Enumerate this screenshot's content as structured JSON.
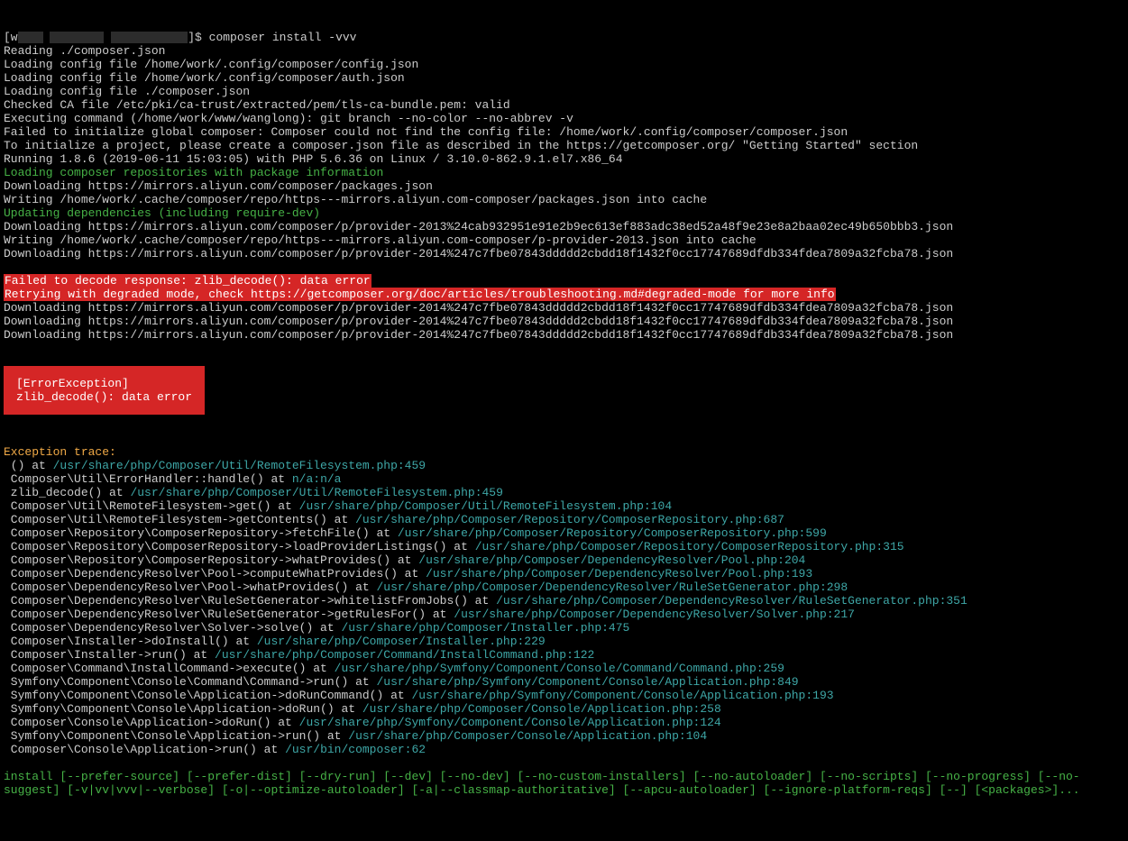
{
  "prompt_prefix": "[w",
  "prompt_suffix": "]$ ",
  "command": "composer install -vvv",
  "lines": [
    "Reading ./composer.json",
    "Loading config file /home/work/.config/composer/config.json",
    "Loading config file /home/work/.config/composer/auth.json",
    "Loading config file ./composer.json",
    "Checked CA file /etc/pki/ca-trust/extracted/pem/tls-ca-bundle.pem: valid",
    "Executing command (/home/work/www/wanglong): git branch --no-color --no-abbrev -v",
    "Failed to initialize global composer: Composer could not find the config file: /home/work/.config/composer/composer.json",
    "To initialize a project, please create a composer.json file as described in the https://getcomposer.org/ \"Getting Started\" section",
    "Running 1.8.6 (2019-06-11 15:03:05) with PHP 5.6.36 on Linux / 3.10.0-862.9.1.el7.x86_64"
  ],
  "status1": "Loading composer repositories with package information",
  "lines2": [
    "Downloading https://mirrors.aliyun.com/composer/packages.json",
    "Writing /home/work/.cache/composer/repo/https---mirrors.aliyun.com-composer/packages.json into cache"
  ],
  "status2": "Updating dependencies (including require-dev)",
  "lines3": [
    "Downloading https://mirrors.aliyun.com/composer/p/provider-2013%24cab932951e91e2b9ec613ef883adc38ed52a48f9e23e8a2baa02ec49b650bbb3.json",
    "Writing /home/work/.cache/composer/repo/https---mirrors.aliyun.com-composer/p-provider-2013.json into cache",
    "Downloading https://mirrors.aliyun.com/composer/p/provider-2014%247c7fbe07843ddddd2cbdd18f1432f0cc17747689dfdb334fdea7809a32fcba78.json"
  ],
  "err_hl1": "Failed to decode response: zlib_decode(): data error",
  "err_hl2": "Retrying with degraded mode, check https://getcomposer.org/doc/articles/troubleshooting.md#degraded-mode for more info",
  "lines4": [
    "Downloading https://mirrors.aliyun.com/composer/p/provider-2014%247c7fbe07843ddddd2cbdd18f1432f0cc17747689dfdb334fdea7809a32fcba78.json",
    "Downloading https://mirrors.aliyun.com/composer/p/provider-2014%247c7fbe07843ddddd2cbdd18f1432f0cc17747689dfdb334fdea7809a32fcba78.json",
    "Downloading https://mirrors.aliyun.com/composer/p/provider-2014%247c7fbe07843ddddd2cbdd18f1432f0cc17747689dfdb334fdea7809a32fcba78.json"
  ],
  "errbox": {
    "title": "[ErrorException]",
    "msg": "zlib_decode(): data error"
  },
  "trace_header": "Exception trace:",
  "trace": [
    {
      "call": " () at ",
      "path": "/usr/share/php/Composer/Util/RemoteFilesystem.php:459"
    },
    {
      "call": " Composer\\Util\\ErrorHandler::handle() at ",
      "path": "n/a:n/a"
    },
    {
      "call": " zlib_decode() at ",
      "path": "/usr/share/php/Composer/Util/RemoteFilesystem.php:459"
    },
    {
      "call": " Composer\\Util\\RemoteFilesystem->get() at ",
      "path": "/usr/share/php/Composer/Util/RemoteFilesystem.php:104"
    },
    {
      "call": " Composer\\Util\\RemoteFilesystem->getContents() at ",
      "path": "/usr/share/php/Composer/Repository/ComposerRepository.php:687"
    },
    {
      "call": " Composer\\Repository\\ComposerRepository->fetchFile() at ",
      "path": "/usr/share/php/Composer/Repository/ComposerRepository.php:599"
    },
    {
      "call": " Composer\\Repository\\ComposerRepository->loadProviderListings() at ",
      "path": "/usr/share/php/Composer/Repository/ComposerRepository.php:315"
    },
    {
      "call": " Composer\\Repository\\ComposerRepository->whatProvides() at ",
      "path": "/usr/share/php/Composer/DependencyResolver/Pool.php:204"
    },
    {
      "call": " Composer\\DependencyResolver\\Pool->computeWhatProvides() at ",
      "path": "/usr/share/php/Composer/DependencyResolver/Pool.php:193"
    },
    {
      "call": " Composer\\DependencyResolver\\Pool->whatProvides() at ",
      "path": "/usr/share/php/Composer/DependencyResolver/RuleSetGenerator.php:298"
    },
    {
      "call": " Composer\\DependencyResolver\\RuleSetGenerator->whitelistFromJobs() at ",
      "path": "/usr/share/php/Composer/DependencyResolver/RuleSetGenerator.php:351"
    },
    {
      "call": " Composer\\DependencyResolver\\RuleSetGenerator->getRulesFor() at ",
      "path": "/usr/share/php/Composer/DependencyResolver/Solver.php:217"
    },
    {
      "call": " Composer\\DependencyResolver\\Solver->solve() at ",
      "path": "/usr/share/php/Composer/Installer.php:475"
    },
    {
      "call": " Composer\\Installer->doInstall() at ",
      "path": "/usr/share/php/Composer/Installer.php:229"
    },
    {
      "call": " Composer\\Installer->run() at ",
      "path": "/usr/share/php/Composer/Command/InstallCommand.php:122"
    },
    {
      "call": " Composer\\Command\\InstallCommand->execute() at ",
      "path": "/usr/share/php/Symfony/Component/Console/Command/Command.php:259"
    },
    {
      "call": " Symfony\\Component\\Console\\Command\\Command->run() at ",
      "path": "/usr/share/php/Symfony/Component/Console/Application.php:849"
    },
    {
      "call": " Symfony\\Component\\Console\\Application->doRunCommand() at ",
      "path": "/usr/share/php/Symfony/Component/Console/Application.php:193"
    },
    {
      "call": " Symfony\\Component\\Console\\Application->doRun() at ",
      "path": "/usr/share/php/Composer/Console/Application.php:258"
    },
    {
      "call": " Composer\\Console\\Application->doRun() at ",
      "path": "/usr/share/php/Symfony/Component/Console/Application.php:124"
    },
    {
      "call": " Symfony\\Component\\Console\\Application->run() at ",
      "path": "/usr/share/php/Composer/Console/Application.php:104"
    },
    {
      "call": " Composer\\Console\\Application->run() at ",
      "path": "/usr/bin/composer:62"
    }
  ],
  "usage": "install [--prefer-source] [--prefer-dist] [--dry-run] [--dev] [--no-dev] [--no-custom-installers] [--no-autoloader] [--no-scripts] [--no-progress] [--no-suggest] [-v|vv|vvv|--verbose] [-o|--optimize-autoloader] [-a|--classmap-authoritative] [--apcu-autoloader] [--ignore-platform-reqs] [--] [<packages>]..."
}
